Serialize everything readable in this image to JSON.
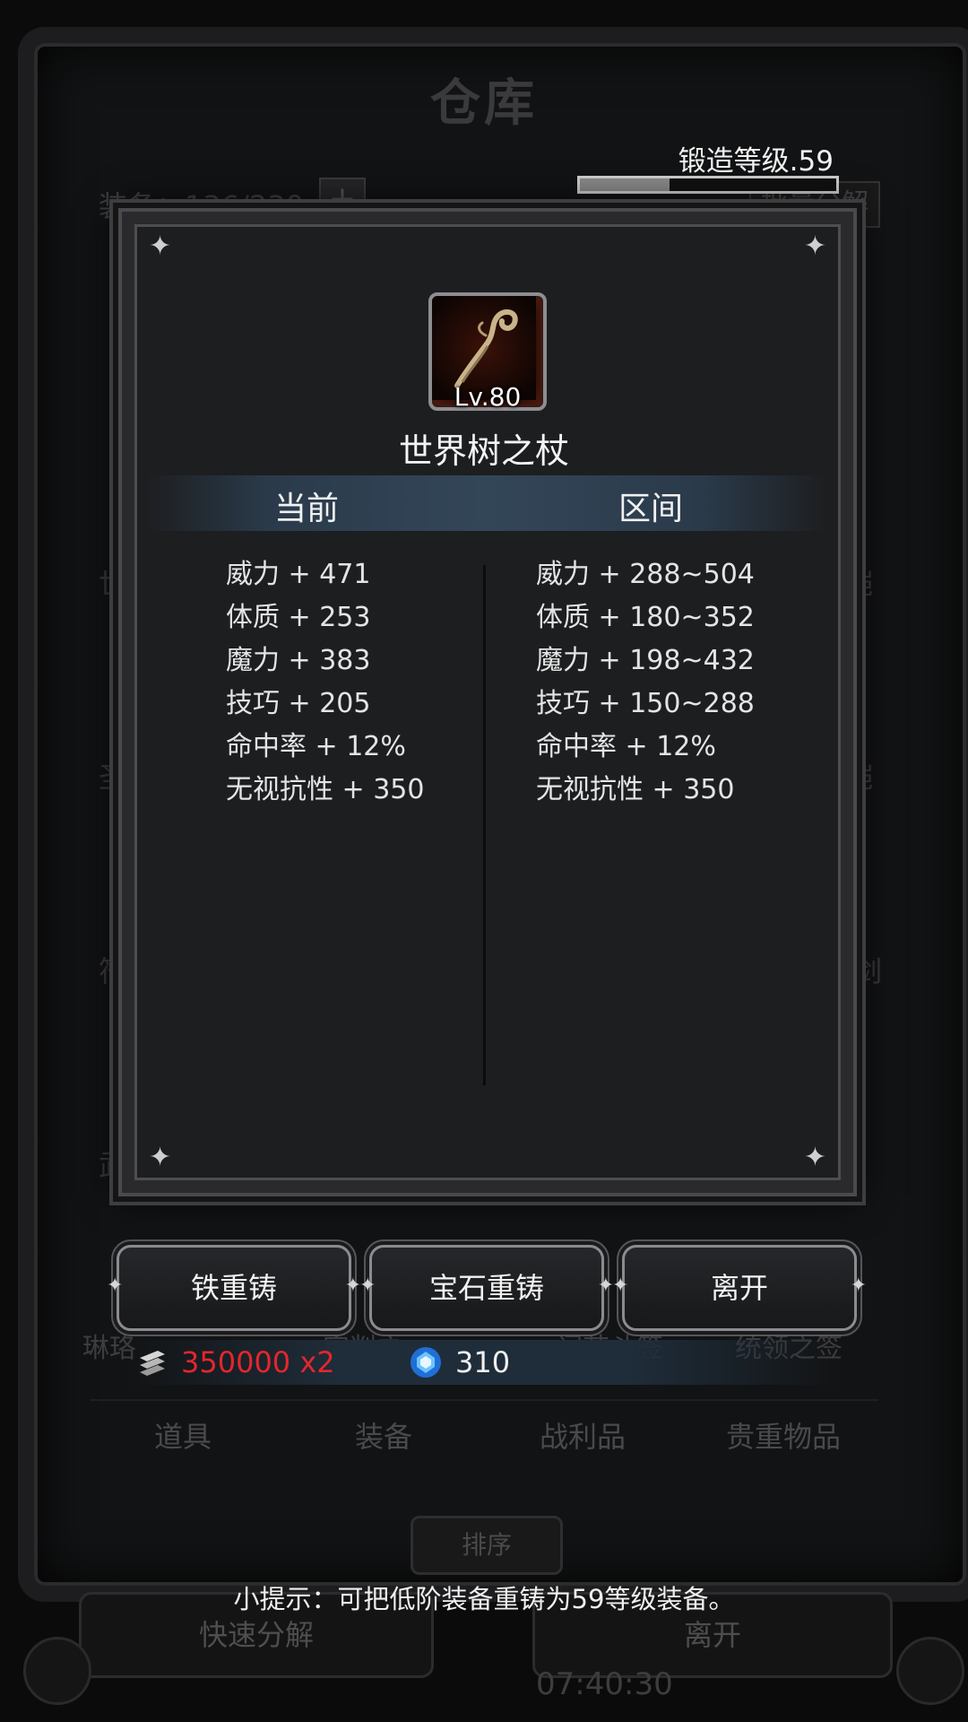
{
  "background": {
    "title": "仓库",
    "equip_count": "装备：136/230",
    "plus": "+",
    "batch_decompose": "批量分解",
    "left_labels": [
      "兰",
      "世",
      "圣",
      "符",
      "武"
    ],
    "right_labels": [
      "铠",
      "铠",
      "长剑"
    ],
    "gear_labels": [
      "琳珞",
      "审判之",
      "闲节斗签",
      "统领之签"
    ],
    "tabs": [
      "道具",
      "装备",
      "战利品",
      "贵重物品"
    ],
    "sort": "排序",
    "quick_decompose": "快速分解",
    "leave": "离开",
    "time": "07:40:30"
  },
  "forge": {
    "label": "锻造等级.59",
    "progress": 0.35
  },
  "item": {
    "level": "Lv.80",
    "name": "世界树之杖"
  },
  "columns": {
    "current": "当前",
    "range": "区间"
  },
  "current_stats": [
    "威力 + 471",
    "体质 + 253",
    "魔力 + 383",
    "技巧 + 205",
    "命中率 + 12%",
    "无视抗性 + 350"
  ],
  "range_stats": [
    "威力 + 288~504",
    "体质 + 180~352",
    "魔力 + 198~432",
    "技巧 + 150~288",
    "命中率 + 12%",
    "无视抗性 + 350"
  ],
  "buttons": {
    "iron_recast": "铁重铸",
    "gem_recast": "宝石重铸",
    "leave": "离开"
  },
  "currency": {
    "iron": "350000 x2",
    "gem": "310"
  },
  "tip": "小提示：可把低阶装备重铸为59等级装备。",
  "colors": {
    "iron_cost": "#e3262d",
    "header_band": "#334658"
  }
}
